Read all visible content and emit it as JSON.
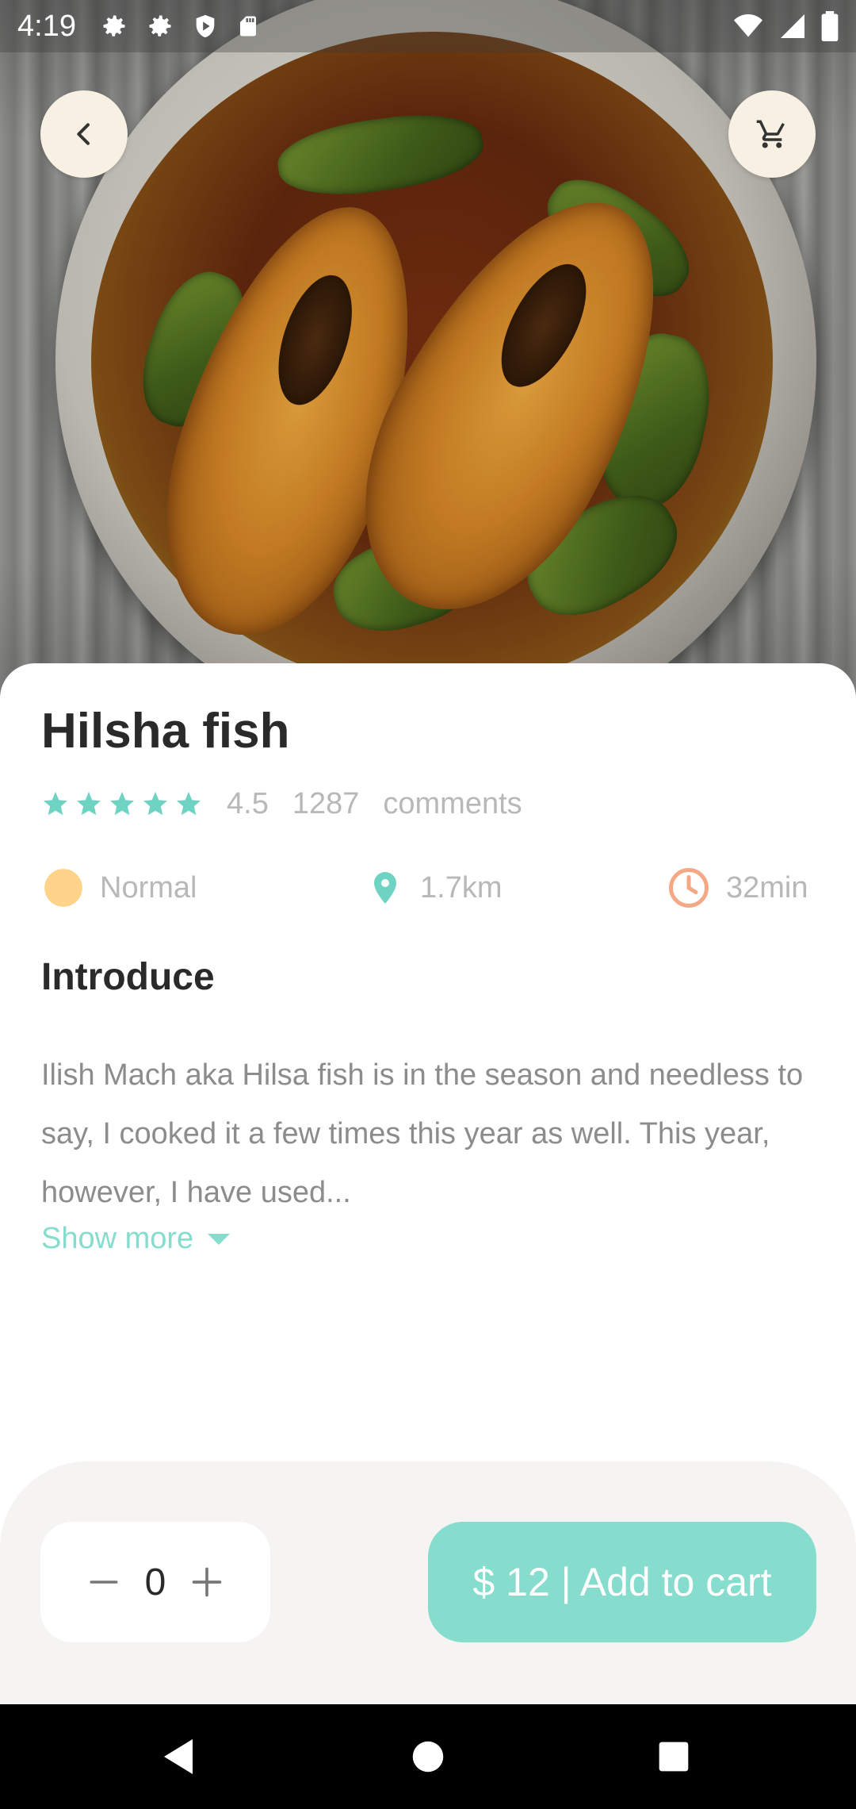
{
  "status_bar": {
    "time": "4:19",
    "left_icons": [
      "settings-icon",
      "settings-icon",
      "shield-play-icon",
      "sd-card-icon"
    ],
    "right_icons": [
      "wifi-icon",
      "signal-icon",
      "battery-icon"
    ]
  },
  "header": {
    "back_icon": "chevron-left-icon",
    "cart_icon": "cart-icon"
  },
  "product": {
    "name": "Hilsha fish",
    "rating": "4.5",
    "stars": 5,
    "comment_count": "1287",
    "comments_label": "comments"
  },
  "meta": {
    "level": "Normal",
    "distance": "1.7km",
    "time": "32min"
  },
  "introduce": {
    "title": "Introduce",
    "text": "Ilish Mach aka Hilsa fish is in the season and needless to say, I cooked it a few times this year as well. This year, however, I have used...",
    "show_more": "Show more"
  },
  "order": {
    "quantity": "0",
    "add_to_cart": "$ 12 | Add to cart"
  },
  "colors": {
    "accent": "#86dccd",
    "level_dot": "#ffd38a",
    "clock": "#f4a886",
    "location": "#6fd3c4",
    "button_bg": "#f7f0e3"
  }
}
